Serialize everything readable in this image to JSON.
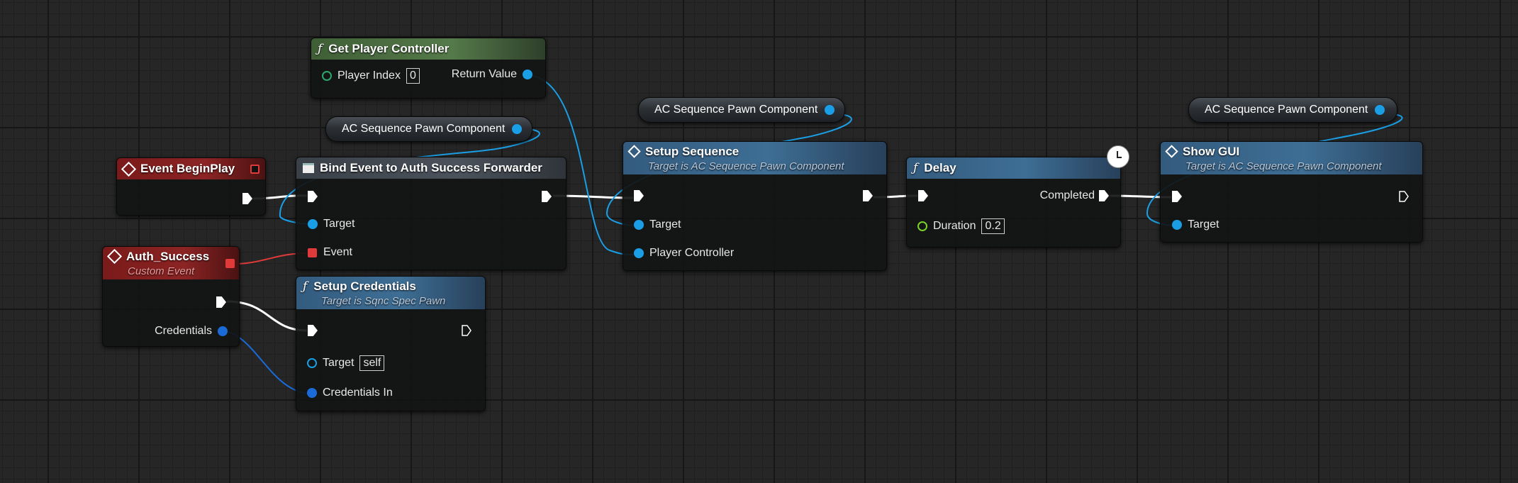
{
  "nodes": {
    "get_player_controller": {
      "title": "Get Player Controller",
      "player_index_label": "Player Index",
      "player_index_value": "0",
      "return_label": "Return Value"
    },
    "ac_pill_1": {
      "label": "AC Sequence Pawn Component"
    },
    "ac_pill_2": {
      "label": "AC Sequence Pawn Component"
    },
    "ac_pill_3": {
      "label": "AC Sequence Pawn Component"
    },
    "event_begin_play": {
      "title": "Event BeginPlay"
    },
    "bind_event": {
      "title": "Bind Event to Auth Success Forwarder",
      "target_label": "Target",
      "event_label": "Event"
    },
    "setup_sequence": {
      "title": "Setup Sequence",
      "subtitle": "Target is AC Sequence Pawn Component",
      "target_label": "Target",
      "pc_label": "Player Controller"
    },
    "delay": {
      "title": "Delay",
      "completed_label": "Completed",
      "duration_label": "Duration",
      "duration_value": "0.2"
    },
    "show_gui": {
      "title": "Show GUI",
      "subtitle": "Target is AC Sequence Pawn Component",
      "target_label": "Target"
    },
    "auth_success": {
      "title": "Auth_Success",
      "subtitle": "Custom Event",
      "credentials_label": "Credentials"
    },
    "setup_credentials": {
      "title": "Setup Credentials",
      "subtitle": "Target is Sqnc Spec Pawn",
      "target_label": "Target",
      "target_value": "self",
      "credentials_in_label": "Credentials In"
    }
  },
  "colors": {
    "exec": "#ffffff",
    "object": "#1a9fe6",
    "struct": "#1a6bd8",
    "delegate": "#e03a3a",
    "float": "#7ad12a"
  },
  "icons": {
    "function": "function-icon",
    "event": "event-diamond-icon",
    "latent": "clock-icon",
    "bind": "bind-event-icon"
  }
}
